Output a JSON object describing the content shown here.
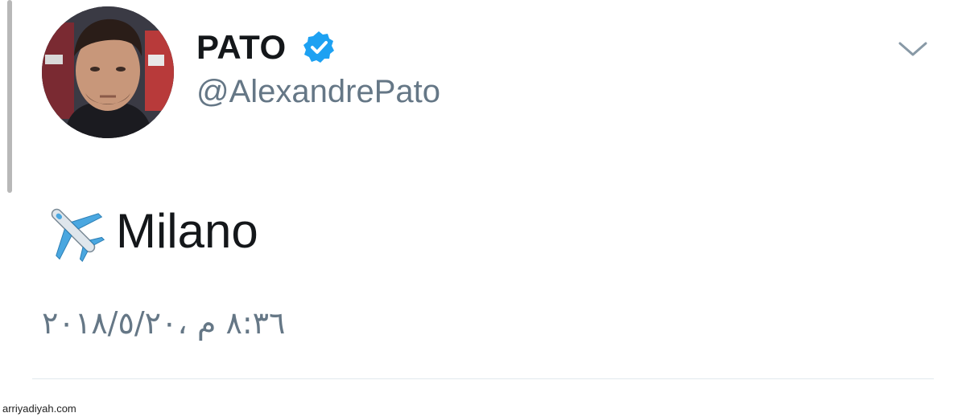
{
  "author": {
    "display_name": "PATO",
    "handle": "@AlexandrePato",
    "verified": true,
    "avatar_icon": "profile-photo"
  },
  "tweet": {
    "emoji_icon": "airplane-icon",
    "text": "Milano",
    "timestamp": "٨:٣٦ م ،٢٠١٨/٥/٢٠"
  },
  "menu": {
    "icon": "chevron-down-icon"
  },
  "watermark": {
    "text": "arriyadiyah.com"
  },
  "colors": {
    "name": "#14171a",
    "secondary": "#657786",
    "verified_badge": "#1da1f2",
    "divider": "#e1e8ed"
  }
}
